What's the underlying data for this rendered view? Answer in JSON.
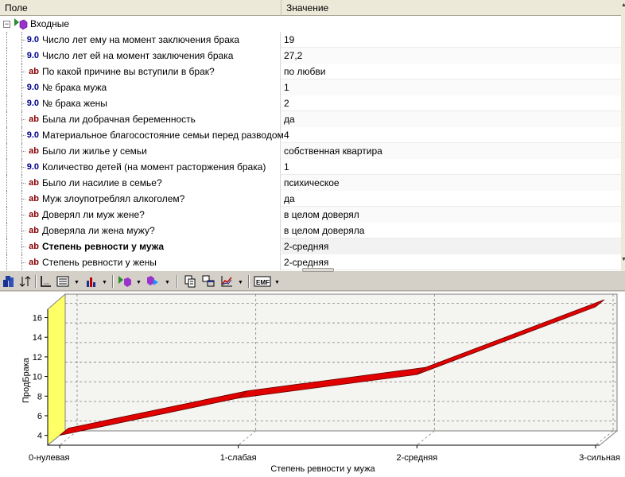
{
  "grid": {
    "headers": {
      "field": "Поле",
      "value": "Значение"
    },
    "root": {
      "label": "Входные",
      "expander": "⊟"
    },
    "rows": [
      {
        "type": "9.0",
        "kind": "num",
        "name": "Число лет ему на момент заключения брака",
        "value": "19"
      },
      {
        "type": "9.0",
        "kind": "num",
        "name": "Число лет ей на момент заключения брака",
        "value": "27,2"
      },
      {
        "type": "ab",
        "kind": "text",
        "name": "По какой причине вы вступили в брак?",
        "value": "по любви"
      },
      {
        "type": "9.0",
        "kind": "num",
        "name": "№ брака мужа",
        "value": "1"
      },
      {
        "type": "9.0",
        "kind": "num",
        "name": "№ брака жены",
        "value": "2"
      },
      {
        "type": "ab",
        "kind": "text",
        "name": "Была ли добрачная беременность",
        "value": "да"
      },
      {
        "type": "9.0",
        "kind": "num",
        "name": "Материальное благосостояние семьи перед разводом",
        "value": "4"
      },
      {
        "type": "ab",
        "kind": "text",
        "name": "Было ли жилье у семьи",
        "value": "собственная квартира"
      },
      {
        "type": "9.0",
        "kind": "num",
        "name": "Количество детей (на момент расторжения брака)",
        "value": "1"
      },
      {
        "type": "ab",
        "kind": "text",
        "name": "Было ли насилие в семье?",
        "value": "психическое"
      },
      {
        "type": "ab",
        "kind": "text",
        "name": "Муж злоупотреблял алкоголем?",
        "value": "да"
      },
      {
        "type": "ab",
        "kind": "text",
        "name": "Доверял ли муж жене?",
        "value": "в целом доверял"
      },
      {
        "type": "ab",
        "kind": "text",
        "name": "Доверяла ли жена мужу?",
        "value": "в целом доверяла"
      },
      {
        "type": "ab",
        "kind": "text",
        "name": "Степень ревности у мужа",
        "value": "2-средняя",
        "selected": true
      },
      {
        "type": "ab",
        "kind": "text",
        "name": "Степень ревности у жены",
        "value": "2-средняя"
      }
    ]
  },
  "toolbar": {
    "buttons": [
      "properties-icon",
      "sort-icon",
      "axis-icon",
      "view-options-icon",
      "bar-chart-icon",
      "input-node-icon",
      "output-node-icon",
      "copy-icon",
      "tile-windows-icon",
      "line-chart-icon",
      "emf-export-icon"
    ],
    "emf_label": "EMF",
    "drop_glyph": "▼"
  },
  "chart_data": {
    "type": "line",
    "categories": [
      "0-нулевая",
      "1-слабая",
      "2-средняя",
      "3-сильная"
    ],
    "values": [
      4.0,
      7.8,
      10.2,
      17.1
    ],
    "xlabel": "Степень ревности у мужа",
    "ylabel": "ПродБрака",
    "yticks": [
      4,
      6,
      8,
      10,
      12,
      14,
      16
    ],
    "ylim": [
      3,
      17.5
    ],
    "grid": true,
    "three_d": true,
    "colors": {
      "line": "#e00000",
      "line_dark": "#600000",
      "wall": "#ffff66",
      "floor": "#ffffff",
      "grid": "#808080"
    }
  }
}
